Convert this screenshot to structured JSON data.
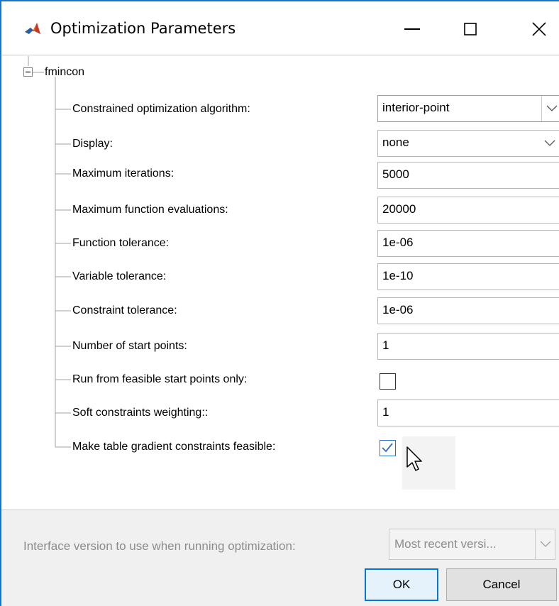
{
  "window": {
    "title": "Optimization Parameters",
    "icon": "matlab-icon"
  },
  "titlebar_buttons": [
    {
      "name": "minimize",
      "icon": "minimize-icon"
    },
    {
      "name": "maximize",
      "icon": "maximize-icon"
    },
    {
      "name": "close",
      "icon": "close-icon"
    }
  ],
  "tree": {
    "root_label": "fmincon",
    "expander_icon": "collapse-icon",
    "parameters": [
      {
        "label": "Constrained optimization algorithm:",
        "type": "dropdown",
        "value": "interior-point"
      },
      {
        "label": "Display:",
        "type": "dropdown",
        "value": "none"
      },
      {
        "label": "Maximum iterations:",
        "type": "text",
        "value": "5000"
      },
      {
        "label": "Maximum function evaluations:",
        "type": "text",
        "value": "20000"
      },
      {
        "label": "Function tolerance:",
        "type": "text",
        "value": "1e-06"
      },
      {
        "label": "Variable tolerance:",
        "type": "text",
        "value": "1e-10"
      },
      {
        "label": "Constraint tolerance:",
        "type": "text",
        "value": "1e-06"
      },
      {
        "label": "Number of start points:",
        "type": "text",
        "value": "1"
      },
      {
        "label": "Run from feasible start points only:",
        "type": "checkbox",
        "checked": false
      },
      {
        "label": "Soft constraints weighting::",
        "type": "text",
        "value": "1"
      },
      {
        "label": "Make table gradient constraints feasible:",
        "type": "checkbox",
        "checked": true
      }
    ]
  },
  "footer": {
    "interface_label": "Interface version to use when running optimization:",
    "interface_value": "Most recent versi...",
    "ok_label": "OK",
    "cancel_label": "Cancel"
  },
  "colors": {
    "accent": "#0078d7",
    "checkmark": "#2d6fc9",
    "tree_lines": "#a0a0a0",
    "disabled_text": "#8c8c8c"
  }
}
